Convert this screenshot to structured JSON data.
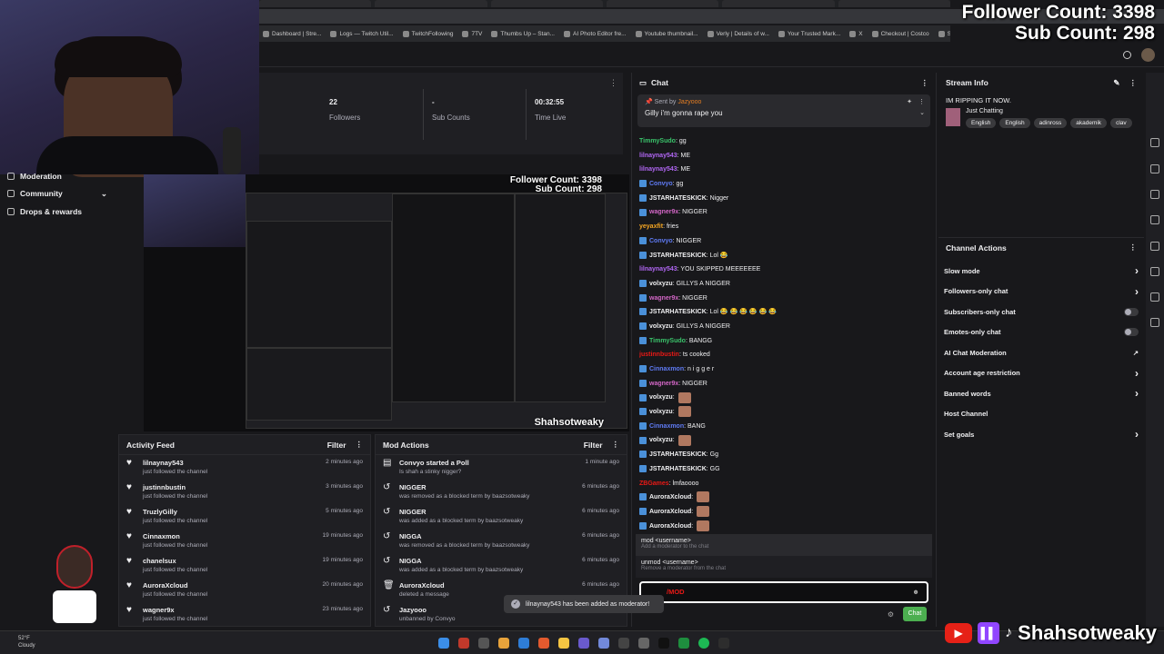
{
  "overlay": {
    "follower_count": "Follower Count: 3398",
    "sub_count": "Sub Count: 298"
  },
  "bookmarks": [
    "Dashboard | Stre...",
    "Logs — Twitch Util...",
    "TwitchFollowing",
    "7TV",
    "Thumbs Up – Stan...",
    "AI Photo Editor fre...",
    "Youtube thumbnail...",
    "Verly | Details of w...",
    "Your Trusted Mark...",
    "X",
    "Checkout | Costco",
    "Stream mission co..."
  ],
  "nav": {
    "items": [
      "Moderation",
      "Community",
      "Drops & rewards"
    ]
  },
  "stats": [
    {
      "value": "22",
      "label": "Followers"
    },
    {
      "value": "-",
      "label": "Sub Counts"
    },
    {
      "value": "00:32:55",
      "label": "Time Live"
    }
  ],
  "preview": {
    "overlay1": "Follower Count: 3398",
    "overlay2": "Sub Count: 298",
    "tag": "Shahsotweaky"
  },
  "activity": {
    "title": "Activity Feed",
    "filter": "Filter",
    "items": [
      {
        "name": "lilnaynay543",
        "sub": "just followed the channel",
        "time": "2 minutes ago"
      },
      {
        "name": "justinnbustin",
        "sub": "just followed the channel",
        "time": "3 minutes ago"
      },
      {
        "name": "TruzlyGilly",
        "sub": "just followed the channel",
        "time": "5 minutes ago"
      },
      {
        "name": "Cinnaxmon",
        "sub": "just followed the channel",
        "time": "19 minutes ago"
      },
      {
        "name": "chanelsux",
        "sub": "just followed the channel",
        "time": "19 minutes ago"
      },
      {
        "name": "AuroraXcloud",
        "sub": "just followed the channel",
        "time": "20 minutes ago"
      },
      {
        "name": "wagner9x",
        "sub": "just followed the channel",
        "time": "23 minutes ago"
      }
    ]
  },
  "modactions": {
    "title": "Mod Actions",
    "filter": "Filter",
    "items": [
      {
        "name": "Convyo started a Poll",
        "sub": "Is shah a stinky nigger?",
        "time": "1 minute ago"
      },
      {
        "name": "NIGGER",
        "sub": "was removed as a blocked term by baazsotweaky",
        "time": "6 minutes ago"
      },
      {
        "name": "NIGGER",
        "sub": "was added as a blocked term by baazsotweaky",
        "time": "6 minutes ago"
      },
      {
        "name": "NIGGA",
        "sub": "was removed as a blocked term by baazsotweaky",
        "time": "6 minutes ago"
      },
      {
        "name": "NIGGA",
        "sub": "was added as a blocked term by baazsotweaky",
        "time": "6 minutes ago"
      },
      {
        "name": "AuroraXcloud",
        "sub": "deleted a message",
        "time": "6 minutes ago"
      },
      {
        "name": "Jazyooo",
        "sub": "unbanned by Convyo",
        "time": ""
      }
    ]
  },
  "chat": {
    "title": "Chat",
    "pinned_by_label": "Sent by",
    "pinned_by": "Jazyooo",
    "pinned_msg": "Gilly i'm gonna rape you",
    "lines": [
      {
        "u": "TimmySudo",
        "c": "#3ac46b",
        "t": ": gg",
        "badge": false
      },
      {
        "u": "lilnaynay543",
        "c": "#b267f5",
        "t": ": ME",
        "badge": false
      },
      {
        "u": "lilnaynay543",
        "c": "#b267f5",
        "t": ": ME",
        "badge": false
      },
      {
        "u": "Convyo",
        "c": "#5f7bf5",
        "t": ": gg",
        "badge": true
      },
      {
        "u": "JSTARHATESKICK",
        "c": "#efeff1",
        "t": ": Nigger",
        "badge": true
      },
      {
        "u": "wagner9x",
        "c": "#d266c6",
        "t": ": NIGGER",
        "badge": true
      },
      {
        "u": "yeyaxfit",
        "c": "#f5a623",
        "t": ": fries",
        "badge": false
      },
      {
        "u": "Convyo",
        "c": "#5f7bf5",
        "t": ": NIGGER",
        "badge": true
      },
      {
        "u": "JSTARHATESKICK",
        "c": "#efeff1",
        "t": ": Lol 😂",
        "badge": true
      },
      {
        "u": "lilnaynay543",
        "c": "#b267f5",
        "t": ": YOU SKIPPED MEEEEEEE",
        "badge": false
      },
      {
        "u": "volxyzu",
        "c": "#efeff1",
        "t": ": GILLYS A NIGGER",
        "badge": true
      },
      {
        "u": "wagner9x",
        "c": "#d266c6",
        "t": ": NIGGER",
        "badge": true
      },
      {
        "u": "JSTARHATESKICK",
        "c": "#efeff1",
        "t": ": Lol 😂 😂 😂 😂 😂 😂",
        "badge": true
      },
      {
        "u": "volxyzu",
        "c": "#efeff1",
        "t": ": GILLYS A NIGGER",
        "badge": true
      },
      {
        "u": "TimmySudo",
        "c": "#3ac46b",
        "t": ": BANGG",
        "badge": true
      },
      {
        "u": "justinnbustin",
        "c": "#e91916",
        "t": ": ts cooked",
        "badge": false
      },
      {
        "u": "Cinnaxmon",
        "c": "#5f7bf5",
        "t": ": n i g g e r",
        "badge": true
      },
      {
        "u": "wagner9x",
        "c": "#d266c6",
        "t": ": NIGGER",
        "badge": true
      },
      {
        "u": "volxyzu",
        "c": "#efeff1",
        "t": ":",
        "badge": true
      },
      {
        "u": "volxyzu",
        "c": "#efeff1",
        "t": ":",
        "badge": true
      },
      {
        "u": "Cinnaxmon",
        "c": "#5f7bf5",
        "t": ": BANG",
        "badge": true
      },
      {
        "u": "volxyzu",
        "c": "#efeff1",
        "t": ":",
        "badge": true
      },
      {
        "u": "JSTARHATESKICK",
        "c": "#efeff1",
        "t": ": Gg",
        "badge": true
      },
      {
        "u": "JSTARHATESKICK",
        "c": "#efeff1",
        "t": ": GG",
        "badge": true
      },
      {
        "u": "ZBGames",
        "c": "#e91916",
        "t": ": lmfaoooo",
        "badge": false
      },
      {
        "u": "AuroraXcloud",
        "c": "#efeff1",
        "t": ":",
        "badge": true
      },
      {
        "u": "AuroraXcloud",
        "c": "#efeff1",
        "t": ":",
        "badge": true
      },
      {
        "u": "AuroraXcloud",
        "c": "#efeff1",
        "t": ":",
        "badge": true
      }
    ],
    "suggest": [
      {
        "cmd": "mod <username>",
        "desc": "Add a moderator to the chat"
      },
      {
        "cmd": "unmod <username>",
        "desc": "Remove a moderator from the chat"
      }
    ],
    "input_value": "/MOD",
    "send_label": "Chat"
  },
  "streaminfo": {
    "title": "Stream Info",
    "stream_title": "IM RIPPING IT NOW.",
    "category": "Just Chatting",
    "tags": [
      "English",
      "English",
      "adinross",
      "akademik",
      "clav"
    ]
  },
  "channelactions": {
    "title": "Channel Actions",
    "items": [
      {
        "label": "Slow mode",
        "ctrl": "chevron"
      },
      {
        "label": "Followers-only chat",
        "ctrl": "chevron"
      },
      {
        "label": "Subscribers-only chat",
        "ctrl": "toggle"
      },
      {
        "label": "Emotes-only chat",
        "ctrl": "toggle"
      },
      {
        "label": "AI Chat Moderation",
        "ctrl": "ext"
      },
      {
        "label": "Account age restriction",
        "ctrl": "chevron"
      },
      {
        "label": "Banned words",
        "ctrl": "chevron"
      },
      {
        "label": "Host Channel",
        "ctrl": "none"
      },
      {
        "label": "Set goals",
        "ctrl": "chevron"
      }
    ]
  },
  "toast": "lilnaynay543 has been added as moderator!",
  "taskbar": {
    "temp": "52°F",
    "cond": "Cloudy"
  },
  "social": {
    "name": "Shahsotweaky"
  }
}
